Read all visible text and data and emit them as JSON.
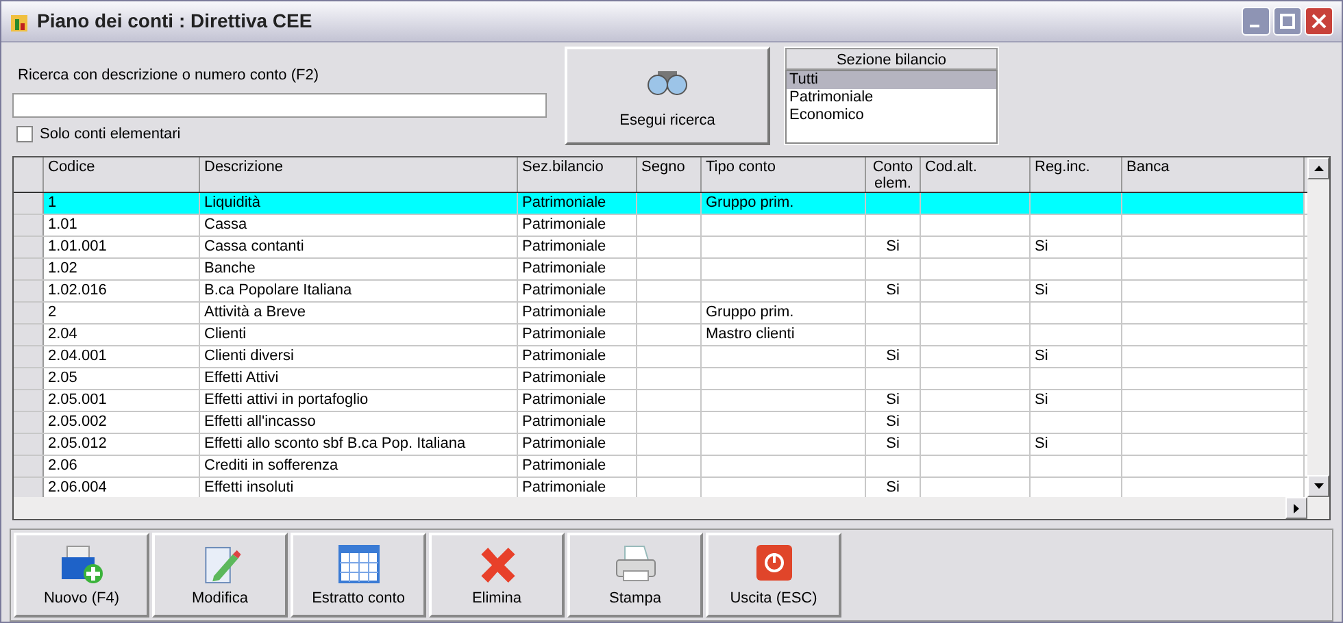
{
  "window": {
    "title": "Piano dei conti : Direttiva CEE"
  },
  "search": {
    "label": "Ricerca con descrizione o numero conto (F2)"
  },
  "only_elementary": {
    "label": "Solo conti elementari",
    "checked": false
  },
  "search_button": {
    "label": "Esegui ricerca"
  },
  "section_list": {
    "title": "Sezione bilancio",
    "items": [
      {
        "label": "Tutti",
        "selected": true
      },
      {
        "label": "Patrimoniale",
        "selected": false
      },
      {
        "label": "Economico",
        "selected": false
      }
    ]
  },
  "table": {
    "columns": [
      {
        "label": "Codice"
      },
      {
        "label": "Descrizione"
      },
      {
        "label": "Sez.bilancio"
      },
      {
        "label": "Segno"
      },
      {
        "label": "Tipo conto"
      },
      {
        "label": "Conto elem."
      },
      {
        "label": "Cod.alt."
      },
      {
        "label": "Reg.inc."
      },
      {
        "label": "Banca"
      }
    ],
    "rows": [
      {
        "selected": true,
        "cells": [
          "1",
          "Liquidità",
          "Patrimoniale",
          "",
          "Gruppo prim.",
          "",
          "",
          "",
          ""
        ]
      },
      {
        "selected": false,
        "cells": [
          "1.01",
          "Cassa",
          "Patrimoniale",
          "",
          "",
          "",
          "",
          "",
          ""
        ]
      },
      {
        "selected": false,
        "cells": [
          "1.01.001",
          "Cassa contanti",
          "Patrimoniale",
          "",
          "",
          "Si",
          "",
          "Si",
          ""
        ]
      },
      {
        "selected": false,
        "cells": [
          "1.02",
          "Banche",
          "Patrimoniale",
          "",
          "",
          "",
          "",
          "",
          ""
        ]
      },
      {
        "selected": false,
        "cells": [
          "1.02.016",
          "B.ca Popolare Italiana",
          "Patrimoniale",
          "",
          "",
          "Si",
          "",
          "Si",
          ""
        ]
      },
      {
        "selected": false,
        "cells": [
          "2",
          "Attività a Breve",
          "Patrimoniale",
          "",
          "Gruppo prim.",
          "",
          "",
          "",
          ""
        ]
      },
      {
        "selected": false,
        "cells": [
          "2.04",
          "Clienti",
          "Patrimoniale",
          "",
          "Mastro clienti",
          "",
          "",
          "",
          ""
        ]
      },
      {
        "selected": false,
        "cells": [
          "2.04.001",
          "Clienti diversi",
          "Patrimoniale",
          "",
          "",
          "Si",
          "",
          "Si",
          ""
        ]
      },
      {
        "selected": false,
        "cells": [
          "2.05",
          "Effetti Attivi",
          "Patrimoniale",
          "",
          "",
          "",
          "",
          "",
          ""
        ]
      },
      {
        "selected": false,
        "cells": [
          "2.05.001",
          "Effetti attivi in portafoglio",
          "Patrimoniale",
          "",
          "",
          "Si",
          "",
          "Si",
          ""
        ]
      },
      {
        "selected": false,
        "cells": [
          "2.05.002",
          "Effetti all'incasso",
          "Patrimoniale",
          "",
          "",
          "Si",
          "",
          "",
          ""
        ]
      },
      {
        "selected": false,
        "cells": [
          "2.05.012",
          "Effetti allo sconto sbf B.ca Pop. Italiana",
          "Patrimoniale",
          "",
          "",
          "Si",
          "",
          "Si",
          ""
        ]
      },
      {
        "selected": false,
        "cells": [
          "2.06",
          "Crediti in sofferenza",
          "Patrimoniale",
          "",
          "",
          "",
          "",
          "",
          ""
        ]
      },
      {
        "selected": false,
        "cells": [
          "2.06.004",
          "Effetti insoluti",
          "Patrimoniale",
          "",
          "",
          "Si",
          "",
          "",
          ""
        ]
      }
    ]
  },
  "toolbar": [
    {
      "label": "Nuovo (F4)",
      "kind": "new"
    },
    {
      "label": "Modifica",
      "kind": "edit"
    },
    {
      "label": "Estratto conto",
      "kind": "calendar"
    },
    {
      "label": "Elimina",
      "kind": "delete"
    },
    {
      "label": "Stampa",
      "kind": "print"
    },
    {
      "label": "Uscita (ESC)",
      "kind": "exit"
    }
  ]
}
